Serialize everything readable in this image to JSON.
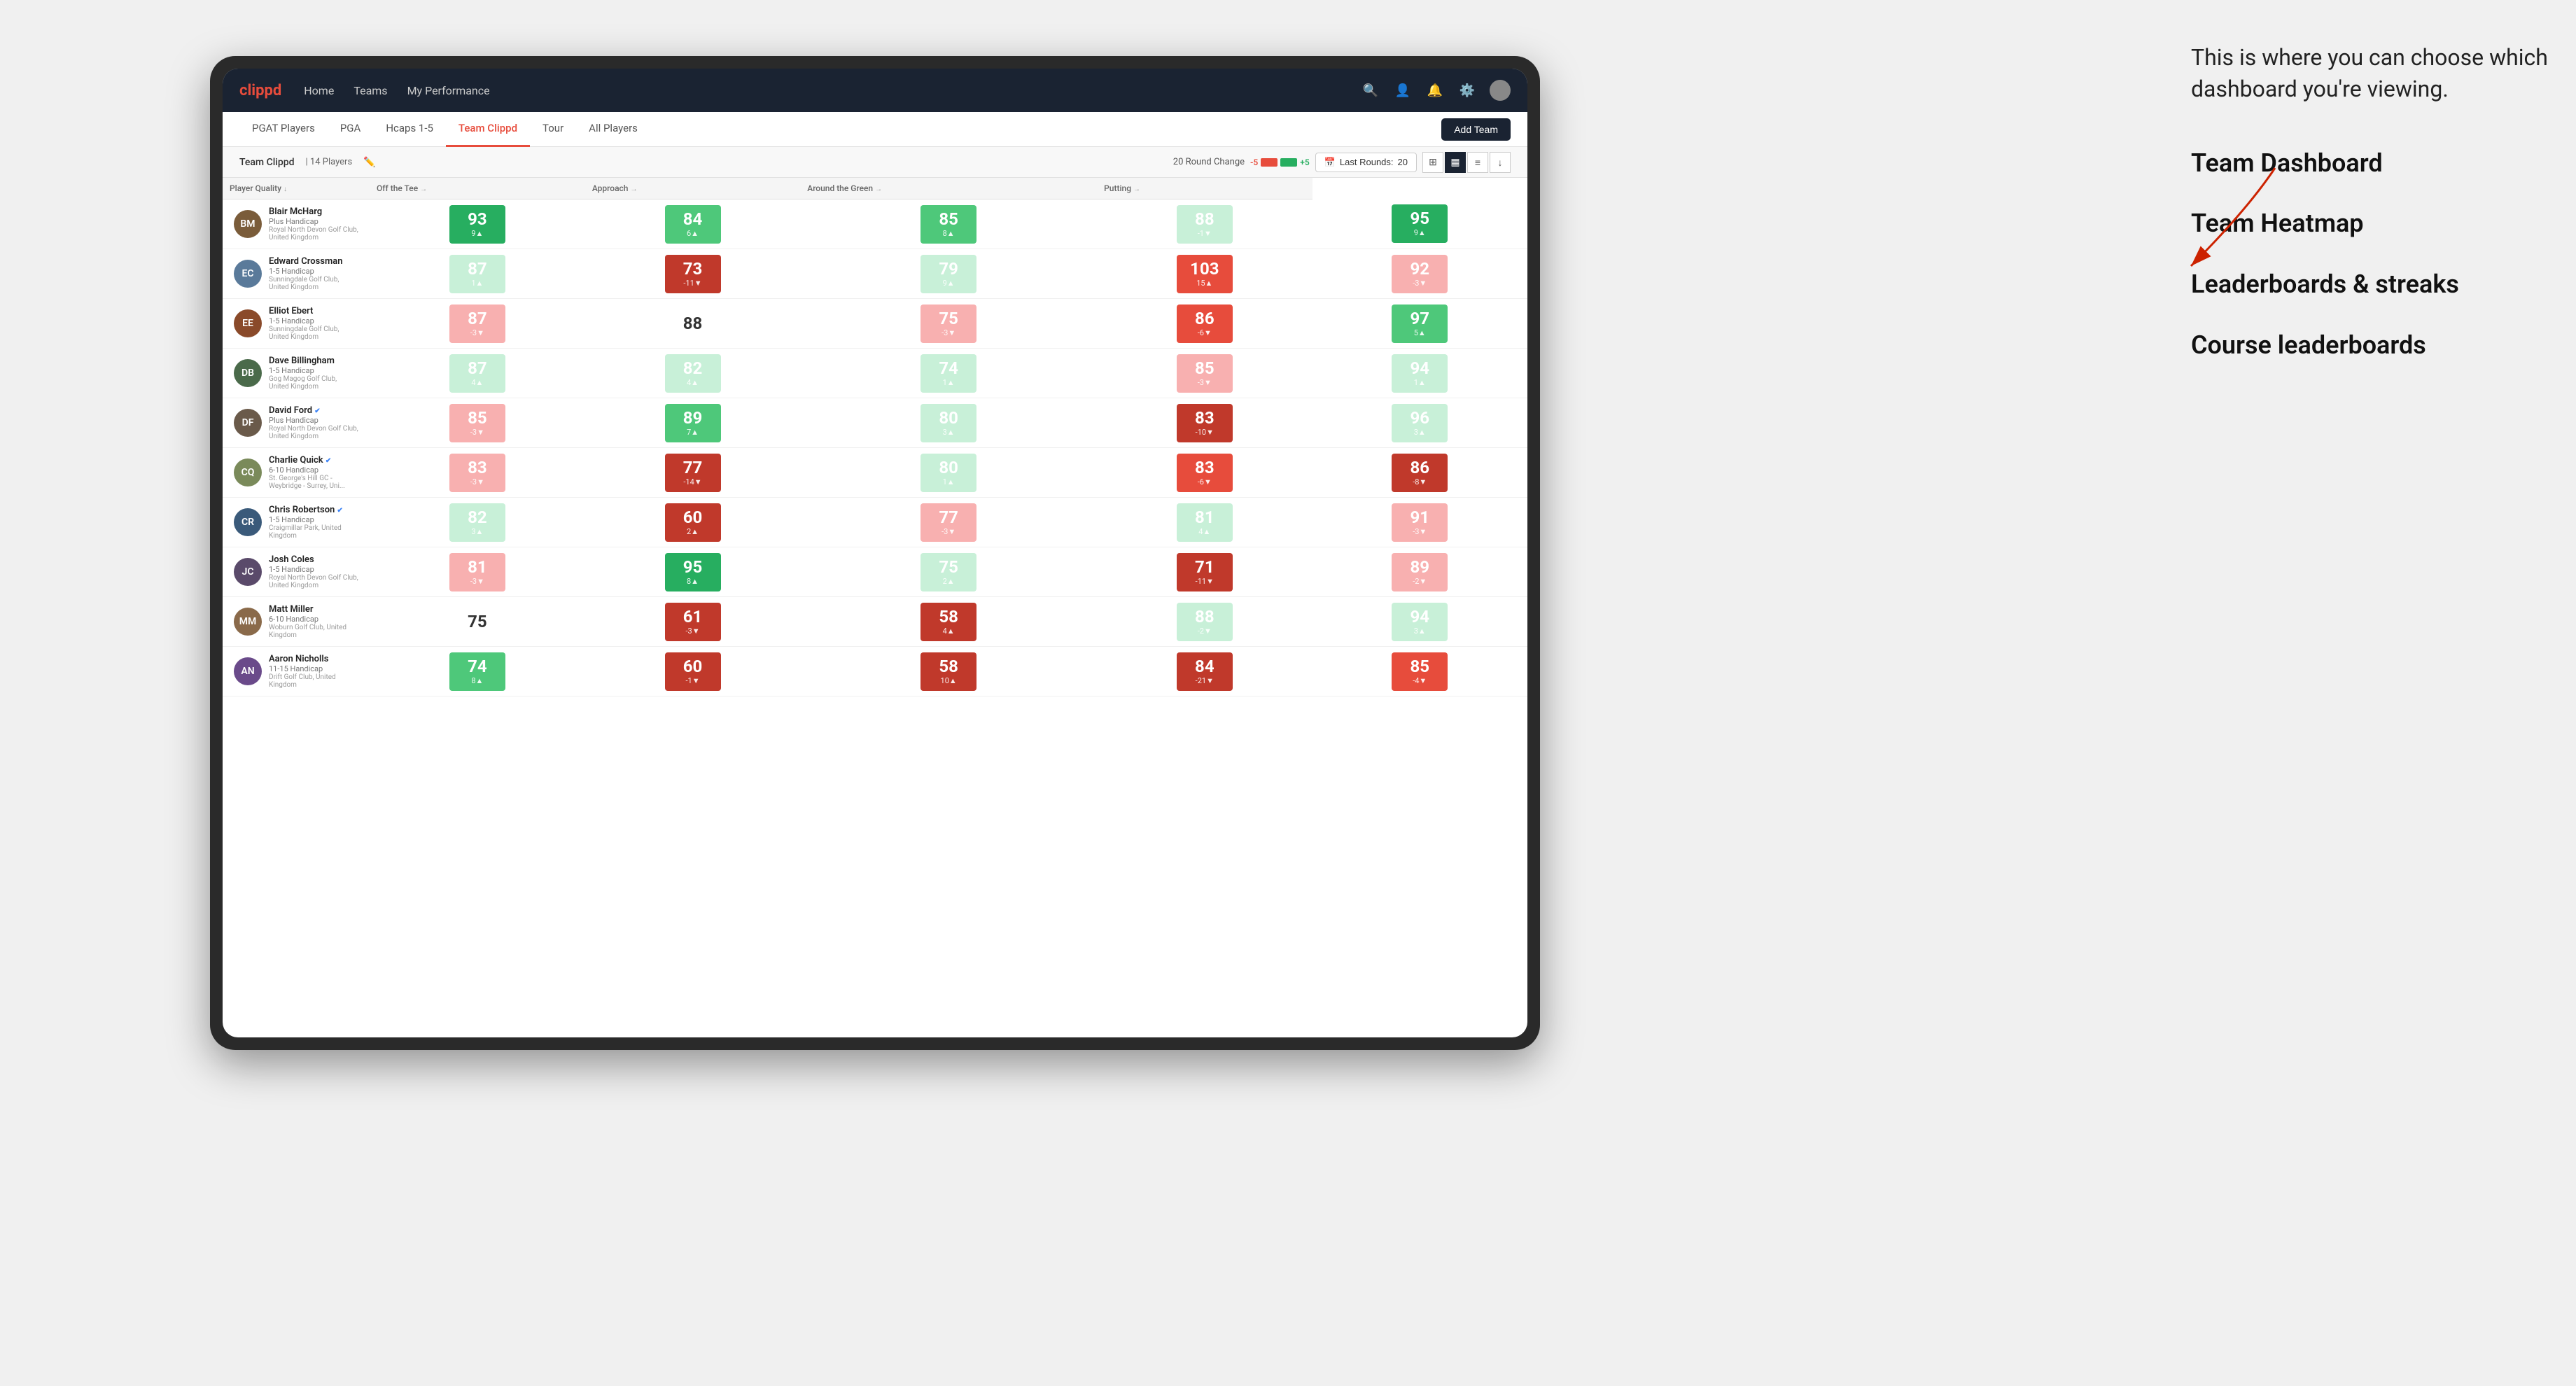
{
  "annotation": {
    "intro": "This is where you can choose which dashboard you're viewing.",
    "menu_items": [
      "Team Dashboard",
      "Team Heatmap",
      "Leaderboards & streaks",
      "Course leaderboards"
    ]
  },
  "navbar": {
    "brand": "clippd",
    "nav_items": [
      "Home",
      "Teams",
      "My Performance"
    ],
    "icons": [
      "search",
      "user",
      "bell",
      "settings",
      "avatar"
    ]
  },
  "subnav": {
    "items": [
      "PGAT Players",
      "PGA",
      "Hcaps 1-5",
      "Team Clippd",
      "Tour",
      "All Players"
    ],
    "active": "Team Clippd",
    "add_team_label": "Add Team"
  },
  "team_header": {
    "team_name": "Team Clippd",
    "separator": "|",
    "player_count": "14 Players",
    "round_change_label": "20 Round Change",
    "round_minus": "-5",
    "round_plus": "+5",
    "last_rounds_label": "Last Rounds:",
    "last_rounds_value": "20",
    "view_options": [
      "grid-small",
      "grid-large",
      "list",
      "download"
    ]
  },
  "table": {
    "columns": [
      {
        "id": "player",
        "label": "Player Quality",
        "arrow": "↓",
        "width": "210"
      },
      {
        "id": "tee",
        "label": "Off the Tee",
        "arrow": "→",
        "width": "90"
      },
      {
        "id": "approach",
        "label": "Approach",
        "arrow": "→",
        "width": "90"
      },
      {
        "id": "around",
        "label": "Around the Green",
        "arrow": "→",
        "width": "90"
      },
      {
        "id": "putting",
        "label": "Putting",
        "arrow": "→",
        "width": "90"
      }
    ],
    "rows": [
      {
        "name": "Blair McHarg",
        "handicap": "Plus Handicap",
        "club": "Royal North Devon Golf Club, United Kingdom",
        "avatar_color": "#7a5c3a",
        "avatar_initials": "BM",
        "scores": [
          {
            "value": "93",
            "change": "9▲",
            "color": "green-dark"
          },
          {
            "value": "84",
            "change": "6▲",
            "color": "green-med"
          },
          {
            "value": "85",
            "change": "8▲",
            "color": "green-med"
          },
          {
            "value": "88",
            "change": "-1▼",
            "color": "green-pale"
          },
          {
            "value": "95",
            "change": "9▲",
            "color": "green-dark"
          }
        ]
      },
      {
        "name": "Edward Crossman",
        "handicap": "1-5 Handicap",
        "club": "Sunningdale Golf Club, United Kingdom",
        "avatar_color": "#5a7a9a",
        "avatar_initials": "EC",
        "scores": [
          {
            "value": "87",
            "change": "1▲",
            "color": "green-pale"
          },
          {
            "value": "73",
            "change": "-11▼",
            "color": "red-dark"
          },
          {
            "value": "79",
            "change": "9▲",
            "color": "green-pale"
          },
          {
            "value": "103",
            "change": "15▲",
            "color": "red-med"
          },
          {
            "value": "92",
            "change": "-3▼",
            "color": "red-light"
          }
        ]
      },
      {
        "name": "Elliot Ebert",
        "handicap": "1-5 Handicap",
        "club": "Sunningdale Golf Club, United Kingdom",
        "avatar_color": "#8a4a2a",
        "avatar_initials": "EE",
        "scores": [
          {
            "value": "87",
            "change": "-3▼",
            "color": "red-light"
          },
          {
            "value": "88",
            "change": "",
            "color": "white-cell"
          },
          {
            "value": "75",
            "change": "-3▼",
            "color": "red-light"
          },
          {
            "value": "86",
            "change": "-6▼",
            "color": "red-med"
          },
          {
            "value": "97",
            "change": "5▲",
            "color": "green-med"
          }
        ]
      },
      {
        "name": "Dave Billingham",
        "handicap": "1-5 Handicap",
        "club": "Gog Magog Golf Club, United Kingdom",
        "avatar_color": "#4a6a4a",
        "avatar_initials": "DB",
        "scores": [
          {
            "value": "87",
            "change": "4▲",
            "color": "green-pale"
          },
          {
            "value": "82",
            "change": "4▲",
            "color": "green-pale"
          },
          {
            "value": "74",
            "change": "1▲",
            "color": "green-pale"
          },
          {
            "value": "85",
            "change": "-3▼",
            "color": "red-light"
          },
          {
            "value": "94",
            "change": "1▲",
            "color": "green-pale"
          }
        ]
      },
      {
        "name": "David Ford",
        "handicap": "Plus Handicap",
        "club": "Royal North Devon Golf Club, United Kingdom",
        "avatar_color": "#6a5a4a",
        "avatar_initials": "DF",
        "verified": true,
        "scores": [
          {
            "value": "85",
            "change": "-3▼",
            "color": "red-light"
          },
          {
            "value": "89",
            "change": "7▲",
            "color": "green-med"
          },
          {
            "value": "80",
            "change": "3▲",
            "color": "green-pale"
          },
          {
            "value": "83",
            "change": "-10▼",
            "color": "red-dark"
          },
          {
            "value": "96",
            "change": "3▲",
            "color": "green-pale"
          }
        ]
      },
      {
        "name": "Charlie Quick",
        "handicap": "6-10 Handicap",
        "club": "St. George's Hill GC - Weybridge - Surrey, Uni...",
        "avatar_color": "#7a8a5a",
        "avatar_initials": "CQ",
        "verified": true,
        "scores": [
          {
            "value": "83",
            "change": "-3▼",
            "color": "red-light"
          },
          {
            "value": "77",
            "change": "-14▼",
            "color": "red-dark"
          },
          {
            "value": "80",
            "change": "1▲",
            "color": "green-pale"
          },
          {
            "value": "83",
            "change": "-6▼",
            "color": "red-med"
          },
          {
            "value": "86",
            "change": "-8▼",
            "color": "red-dark"
          }
        ]
      },
      {
        "name": "Chris Robertson",
        "handicap": "1-5 Handicap",
        "club": "Craigmillar Park, United Kingdom",
        "avatar_color": "#3a5a7a",
        "avatar_initials": "CR",
        "verified": true,
        "scores": [
          {
            "value": "82",
            "change": "3▲",
            "color": "green-pale"
          },
          {
            "value": "60",
            "change": "2▲",
            "color": "red-dark"
          },
          {
            "value": "77",
            "change": "-3▼",
            "color": "red-light"
          },
          {
            "value": "81",
            "change": "4▲",
            "color": "green-pale"
          },
          {
            "value": "91",
            "change": "-3▼",
            "color": "red-light"
          }
        ]
      },
      {
        "name": "Josh Coles",
        "handicap": "1-5 Handicap",
        "club": "Royal North Devon Golf Club, United Kingdom",
        "avatar_color": "#5a4a6a",
        "avatar_initials": "JC",
        "scores": [
          {
            "value": "81",
            "change": "-3▼",
            "color": "red-light"
          },
          {
            "value": "95",
            "change": "8▲",
            "color": "green-dark"
          },
          {
            "value": "75",
            "change": "2▲",
            "color": "green-pale"
          },
          {
            "value": "71",
            "change": "-11▼",
            "color": "red-dark"
          },
          {
            "value": "89",
            "change": "-2▼",
            "color": "red-light"
          }
        ]
      },
      {
        "name": "Matt Miller",
        "handicap": "6-10 Handicap",
        "club": "Woburn Golf Club, United Kingdom",
        "avatar_color": "#8a6a4a",
        "avatar_initials": "MM",
        "scores": [
          {
            "value": "75",
            "change": "",
            "color": "white-cell"
          },
          {
            "value": "61",
            "change": "-3▼",
            "color": "red-dark"
          },
          {
            "value": "58",
            "change": "4▲",
            "color": "red-dark"
          },
          {
            "value": "88",
            "change": "-2▼",
            "color": "green-pale"
          },
          {
            "value": "94",
            "change": "3▲",
            "color": "green-pale"
          }
        ]
      },
      {
        "name": "Aaron Nicholls",
        "handicap": "11-15 Handicap",
        "club": "Drift Golf Club, United Kingdom",
        "avatar_color": "#6a4a8a",
        "avatar_initials": "AN",
        "scores": [
          {
            "value": "74",
            "change": "8▲",
            "color": "green-med"
          },
          {
            "value": "60",
            "change": "-1▼",
            "color": "red-dark"
          },
          {
            "value": "58",
            "change": "10▲",
            "color": "red-dark"
          },
          {
            "value": "84",
            "change": "-21▼",
            "color": "red-dark"
          },
          {
            "value": "85",
            "change": "-4▼",
            "color": "red-med"
          }
        ]
      }
    ]
  }
}
